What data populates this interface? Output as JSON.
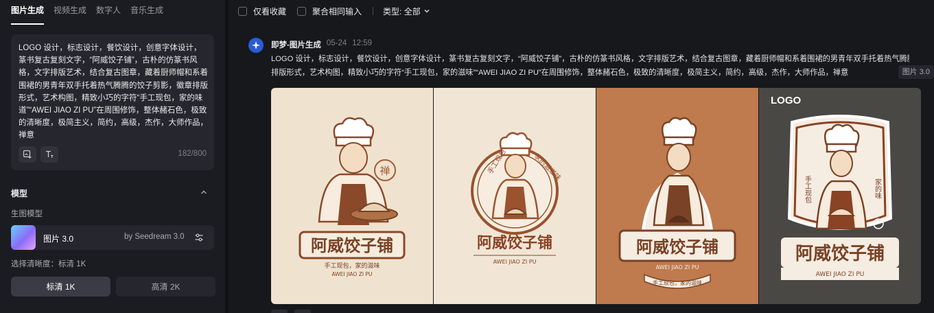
{
  "tabs": [
    {
      "label": "图片生成",
      "active": true
    },
    {
      "label": "视频生成",
      "active": false
    },
    {
      "label": "数字人",
      "active": false
    },
    {
      "label": "音乐生成",
      "active": false
    }
  ],
  "prompt": {
    "text": "LOGO 设计，标志设计，餐饮设计，创意字体设计，篆书复古复刻文字，“阿威饺子铺”，古朴的仿篆书风格，文字排版艺术，结合复古图章，藏着厨师帽和系着围裙的男青年双手托着热气腾腾的饺子剪影，徽章排版形式，艺术构图，精致小巧的字符“手工现包，家的味道”“AWEI JIAO ZI PU”在周围修饰，整体赭石色，极致的清晰度，极简主义，简约，高级，杰作，大师作品，禅意",
    "counter": "182/800"
  },
  "model_section": {
    "title": "模型",
    "sub_label": "生图模型",
    "model_name": "图片 3.0",
    "model_by": "by Seedream 3.0",
    "quality_label": "选择清晰度：标清 1K",
    "quality_options": [
      "标清 1K",
      "高清 2K"
    ]
  },
  "toolbar": {
    "only_fav": "仅看收藏",
    "merge": "聚合相同输入",
    "type_label": "类型: 全部"
  },
  "message": {
    "name": "即梦-图片生成",
    "date": "05-24",
    "time": "12:59",
    "line1": "LOGO 设计，标志设计，餐饮设计，创意字体设计，篆书复古复刻文字，“阿威饺子铺”，古朴的仿篆书风格，文字排版艺术，结合复古图章，藏着厨师帽和系着围裙的男青年双手托着热气腾腾的饺子剪影，徽章",
    "line2": "排版形式，艺术构图，精致小巧的字符“手工现包，家的滋味”“AWEI JIAO ZI PU”在周围修饰，整体赭石色，极致的清晰度，极简主义，简约，高级，杰作，大师作品，禅意",
    "img_count": "图片 3.0"
  },
  "images": [
    {
      "title": "阿威饺子铺",
      "sub1": "手工现包，家的滋味",
      "sub2": "AWEI JIAO ZI PU",
      "stamp": "禅"
    },
    {
      "title": "阿威饺子铺",
      "sub2": "AWEI JIAO ZI PU",
      "arc_left": "手工现包",
      "arc_right": "家的滋滋味"
    },
    {
      "title": "阿威饺子铺",
      "sub2": "AWEI JIAO ZI PU",
      "sub1": "手工现包，家的滋味"
    },
    {
      "tag": "LOGO",
      "title": "阿威饺子铺",
      "sub2": "AWEI JIAO ZI PU",
      "side_left": "手工现包",
      "side_right": "家的味"
    }
  ],
  "colors": {
    "accent_blue": "#2a5bd7",
    "ochre": "#b0643a",
    "brown": "#7a4226"
  }
}
